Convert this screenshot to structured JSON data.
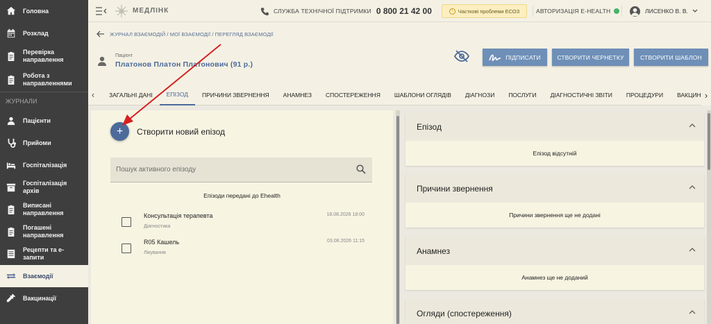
{
  "sidebar": {
    "items_top": [
      {
        "label": "Головна",
        "icon": "home-icon"
      },
      {
        "label": "Розклад",
        "icon": "calendar-icon"
      },
      {
        "label": "Перевірка направлення",
        "icon": "clipboard-check-icon"
      },
      {
        "label": "Робота з направленнями",
        "icon": "clipboard-icon"
      }
    ],
    "section_label": "ЖУРНАЛИ",
    "items": [
      {
        "label": "Пацієнти",
        "icon": "person-icon"
      },
      {
        "label": "Прийоми",
        "icon": "stethoscope-icon"
      },
      {
        "label": "Госпіталізація",
        "icon": "bed-icon"
      },
      {
        "label": "Госпіталізація архів",
        "icon": "archive-icon"
      },
      {
        "label": "Виписані направлення",
        "icon": "clipboard-icon"
      },
      {
        "label": "Погашені направлення",
        "icon": "clipboard-icon"
      },
      {
        "label": "Рецепти та е-запити",
        "icon": "list-icon"
      },
      {
        "label": "Взаємодії",
        "icon": "swap-icon",
        "active": true
      },
      {
        "label": "Вакцинації",
        "icon": "syringe-icon"
      }
    ]
  },
  "header": {
    "logo_text": "МЕДЛІНК",
    "support_label": "СЛУЖБА ТЕХНІЧНОЇ ПІДТРИМКИ",
    "support_phone": "0 800 21 42 00",
    "warning_badge": "Часткові проблеми ЕСОЗ",
    "ehealth_label": "АВТОРИЗАЦІЯ E-HEALTH",
    "ehealth_status_color": "#47b36b",
    "user_name": "ЛИСЕНКО В. В."
  },
  "page": {
    "breadcrumb": "ЖУРНАЛ ВЗАЄМОДІЙ / МОЇ ВЗАЄМОДІЇ / ПЕРЕГЛЯД ВЗАЄМОДІЇ",
    "patient_label": "Пацієнт",
    "patient_name": "Платонов Платон Платонович (91 р.)",
    "buttons": {
      "sign": "ПІДПИСАТИ",
      "draft": "СТВОРИТИ ЧЕРНЕТКУ",
      "template": "СТВОРИТИ ШАБЛОН"
    }
  },
  "tabs": [
    {
      "label": "ЗАГАЛЬНІ ДАНІ"
    },
    {
      "label": "ЕПІЗОД",
      "active": true
    },
    {
      "label": "ПРИЧИНИ ЗВЕРНЕННЯ"
    },
    {
      "label": "АНАМНЕЗ"
    },
    {
      "label": "СПОСТЕРЕЖЕННЯ"
    },
    {
      "label": "ШАБЛОНИ ОГЛЯДІВ"
    },
    {
      "label": "ДІАГНОЗИ"
    },
    {
      "label": "ПОСЛУГИ"
    },
    {
      "label": "ДІАГНОСТИЧНІ ЗВІТИ"
    },
    {
      "label": "ПРОЦЕДУРИ"
    },
    {
      "label": "ВАКЦИН"
    }
  ],
  "episodes": {
    "create_label": "Створити новий епізод",
    "search_placeholder": "Пошук активного епізоду",
    "list_header": "Епізоди передані до Ehealth",
    "items": [
      {
        "title": "Консультація терапевта",
        "type": "Діагностика",
        "date": "18.08.2026 18:00"
      },
      {
        "title": "R05 Кашель",
        "type": "Лікування",
        "date": "03.08.2026 11:15"
      }
    ]
  },
  "cards": [
    {
      "title": "Епізод",
      "body": "Епізод відсутній"
    },
    {
      "title": "Причини звернення",
      "body": "Причини звернення ще не додані"
    },
    {
      "title": "Анамнез",
      "body": "Анамнез ще не доданий"
    },
    {
      "title": "Огляди (спостереження)",
      "body": ""
    }
  ],
  "colors": {
    "accent": "#4c6a9a",
    "button": "#6e8fb7",
    "sidebar": "#3e3e3e",
    "annotation_arrow": "#d62020"
  }
}
